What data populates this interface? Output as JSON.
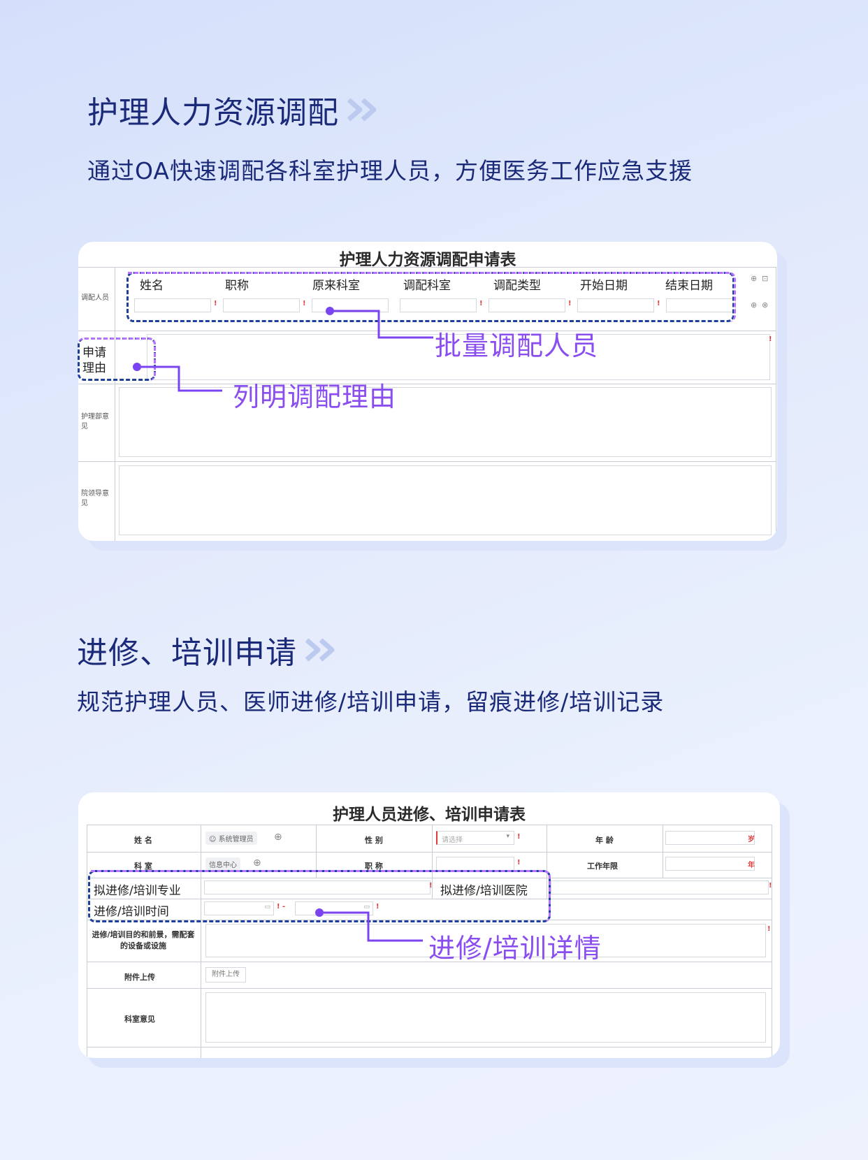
{
  "section1": {
    "title": "护理人力资源调配",
    "subtitle": "通过OA快速调配各科室护理人员，方便医务工作应急支援",
    "form": {
      "title": "护理人力资源调配申请表",
      "row_label_staff": "调配人员",
      "columns": [
        "姓名",
        "职称",
        "原来科室",
        "调配科室",
        "调配类型",
        "开始日期",
        "结束日期"
      ],
      "row_label_reason": "申请理由",
      "row_label_nursing": "护理部意见",
      "row_label_leader": "院领导意见"
    },
    "callout_batch": "批量调配人员",
    "callout_reason": "列明调配理由"
  },
  "section2": {
    "title": "进修、培训申请",
    "subtitle": "规范护理人员、医师进修/培训申请，留痕进修/培训记录",
    "form": {
      "title": "护理人员进修、培训申请表",
      "name_label": "姓 名",
      "name_value": "系统管理员",
      "gender_label": "性 别",
      "gender_placeholder": "请选择",
      "age_label": "年 龄",
      "age_unit": "岁",
      "dept_label": "科 室",
      "dept_value": "信息中心",
      "title_label": "职 称",
      "years_label": "工作年限",
      "years_unit": "年",
      "major_label": "拟进修/培训专业",
      "hospital_label": "拟进修/培训医院",
      "time_label": "进修/培训时间",
      "purpose_label": "进修/培训目的和前景，需配套的设备或设施",
      "attach_label": "附件上传",
      "attach_button": "附件上传",
      "dept_opinion_label": "科室意见"
    },
    "callout_detail": "进修/培训详情"
  },
  "colors": {
    "title": "#1b2a78",
    "callout": "#8a4df0",
    "dash_blue": "#1e3f9a",
    "dash_purple": "#b573ff",
    "required": "#e23b3b"
  }
}
